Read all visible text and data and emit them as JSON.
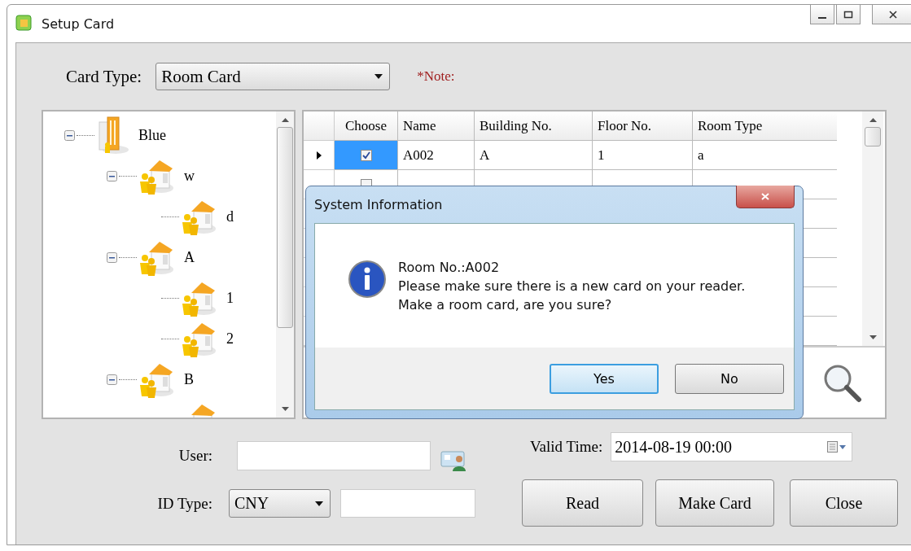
{
  "window": {
    "title": "Setup Card"
  },
  "card_type": {
    "label": "Card Type:",
    "value": "Room Card"
  },
  "note": "*Note:",
  "tree": [
    {
      "label": "Blue",
      "kind": "building",
      "expanded": true,
      "children": [
        {
          "label": "w",
          "kind": "floor",
          "expanded": true,
          "children": [
            {
              "label": "d",
              "kind": "floor"
            }
          ]
        },
        {
          "label": "A",
          "kind": "floor",
          "expanded": true,
          "children": [
            {
              "label": "1",
              "kind": "floor"
            },
            {
              "label": "2",
              "kind": "floor"
            }
          ]
        },
        {
          "label": "B",
          "kind": "floor",
          "expanded": true,
          "children": [
            {
              "kind": "floor"
            }
          ]
        }
      ]
    }
  ],
  "grid": {
    "columns": [
      "Choose",
      "Name",
      "Building No.",
      "Floor No.",
      "Room Type"
    ],
    "rows": [
      {
        "selected": true,
        "checked": true,
        "cells": [
          "A002",
          "A",
          "1",
          "a"
        ]
      },
      {
        "selected": false,
        "checked": false
      }
    ]
  },
  "dialog": {
    "title": "System Information",
    "lines": [
      "Room No.:A002",
      "Please make sure there is a new card on your reader.",
      "Make a room card, are you sure?"
    ],
    "buttons": [
      {
        "label": "Yes",
        "default": true
      },
      {
        "label": "No",
        "default": false
      }
    ]
  },
  "user": {
    "label": "User:"
  },
  "id_type": {
    "label": "ID Type:",
    "value": "CNY"
  },
  "valid_time": {
    "label": "Valid Time:",
    "value": "2014-08-19 00:00"
  },
  "buttons": [
    "Read",
    "Make Card",
    "Close"
  ]
}
